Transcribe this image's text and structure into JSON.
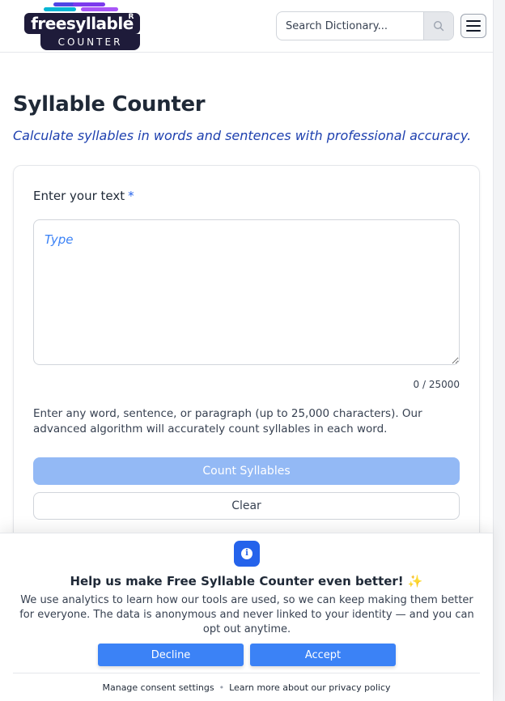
{
  "header": {
    "logo_text": "freesyllable",
    "logo_subtext": "COUNTER",
    "logo_mark": "R",
    "search_placeholder": "Search Dictionary..."
  },
  "main": {
    "title": "Syllable Counter",
    "subtitle": "Calculate syllables in words and sentences with professional accuracy.",
    "input_label": "Enter your text",
    "required_mark": "*",
    "textarea_placeholder": "Type",
    "textarea_value": "",
    "char_counter": "0 / 25000",
    "help_text": "Enter any word, sentence, or paragraph (up to 25,000 characters). Our advanced algorithm will accurately count syllables in each word.",
    "count_button": "Count Syllables",
    "clear_button": "Clear"
  },
  "consent": {
    "title": "Help us make Free Syllable Counter even better! ✨",
    "text": "We use analytics to learn how our tools are used, so we can keep making them better for everyone. The data is anonymous and never linked to your identity — and you can opt out anytime.",
    "decline_label": "Decline",
    "accept_label": "Accept",
    "manage_link": "Manage consent settings",
    "privacy_link": "Learn more about our privacy policy"
  },
  "colors": {
    "accent": "#3b82f6",
    "accent_dark": "#2563eb",
    "disabled_button": "#93b9f5",
    "logo_bg": "#1e1b3a"
  },
  "icons": {
    "search": "search-icon",
    "menu": "hamburger-menu-icon",
    "info": "info-icon"
  }
}
